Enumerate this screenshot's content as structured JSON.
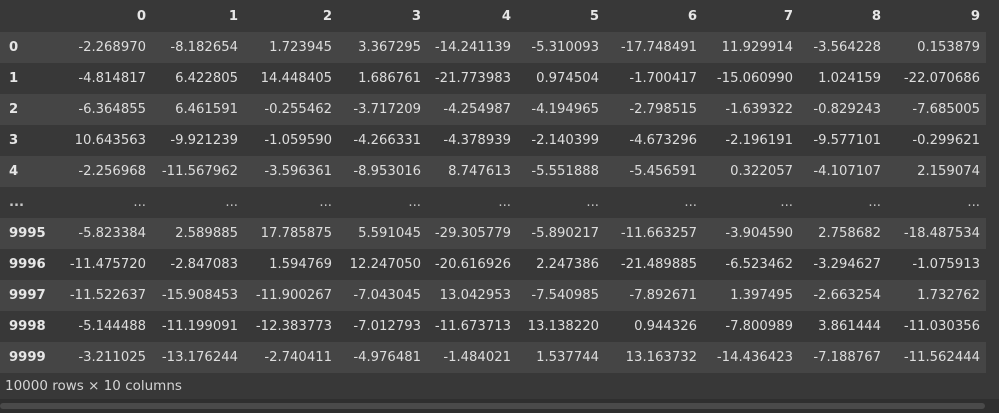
{
  "table": {
    "columns": [
      "0",
      "1",
      "2",
      "3",
      "4",
      "5",
      "6",
      "7",
      "8",
      "9"
    ],
    "rows": [
      {
        "index": "0",
        "cells": [
          "-2.268970",
          "-8.182654",
          "1.723945",
          "3.367295",
          "-14.241139",
          "-5.310093",
          "-17.748491",
          "11.929914",
          "-3.564228",
          "0.153879"
        ]
      },
      {
        "index": "1",
        "cells": [
          "-4.814817",
          "6.422805",
          "14.448405",
          "1.686761",
          "-21.773983",
          "0.974504",
          "-1.700417",
          "-15.060990",
          "1.024159",
          "-22.070686"
        ]
      },
      {
        "index": "2",
        "cells": [
          "-6.364855",
          "6.461591",
          "-0.255462",
          "-3.717209",
          "-4.254987",
          "-4.194965",
          "-2.798515",
          "-1.639322",
          "-0.829243",
          "-7.685005"
        ]
      },
      {
        "index": "3",
        "cells": [
          "10.643563",
          "-9.921239",
          "-1.059590",
          "-4.266331",
          "-4.378939",
          "-2.140399",
          "-4.673296",
          "-2.196191",
          "-9.577101",
          "-0.299621"
        ]
      },
      {
        "index": "4",
        "cells": [
          "-2.256968",
          "-11.567962",
          "-3.596361",
          "-8.953016",
          "8.747613",
          "-5.551888",
          "-5.456591",
          "0.322057",
          "-4.107107",
          "2.159074"
        ]
      },
      {
        "index": "...",
        "cells": [
          "...",
          "...",
          "...",
          "...",
          "...",
          "...",
          "...",
          "...",
          "...",
          "..."
        ]
      },
      {
        "index": "9995",
        "cells": [
          "-5.823384",
          "2.589885",
          "17.785875",
          "5.591045",
          "-29.305779",
          "-5.890217",
          "-11.663257",
          "-3.904590",
          "2.758682",
          "-18.487534"
        ]
      },
      {
        "index": "9996",
        "cells": [
          "-11.475720",
          "-2.847083",
          "1.594769",
          "12.247050",
          "-20.616926",
          "2.247386",
          "-21.489885",
          "-6.523462",
          "-3.294627",
          "-1.075913"
        ]
      },
      {
        "index": "9997",
        "cells": [
          "-11.522637",
          "-15.908453",
          "-11.900267",
          "-7.043045",
          "13.042953",
          "-7.540985",
          "-7.892671",
          "1.397495",
          "-2.663254",
          "1.732762"
        ]
      },
      {
        "index": "9998",
        "cells": [
          "-5.144488",
          "-11.199091",
          "-12.383773",
          "-7.012793",
          "-11.673713",
          "13.138220",
          "0.944326",
          "-7.800989",
          "3.861444",
          "-11.030356"
        ]
      },
      {
        "index": "9999",
        "cells": [
          "-3.211025",
          "-13.176244",
          "-2.740411",
          "-4.976481",
          "-1.484021",
          "1.537744",
          "13.163732",
          "-14.436423",
          "-7.188767",
          "-11.562444"
        ]
      }
    ]
  },
  "footer": {
    "summary": "10000 rows × 10 columns"
  }
}
